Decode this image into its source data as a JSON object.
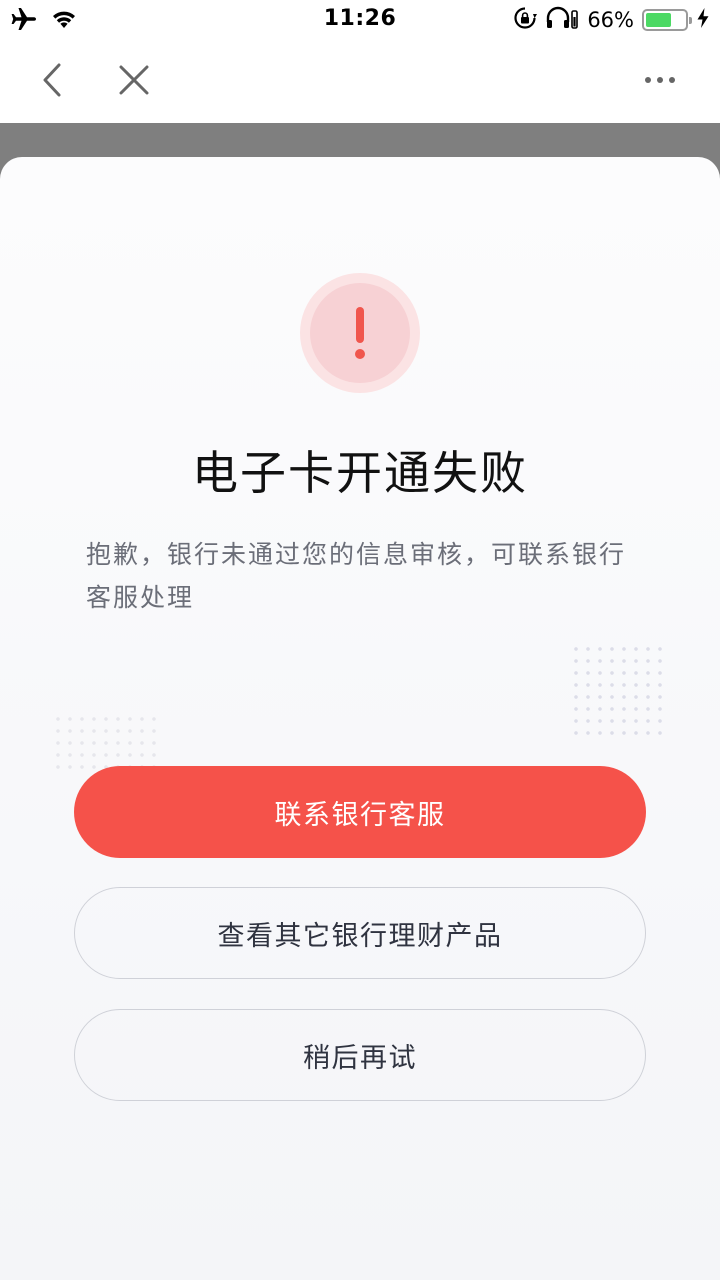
{
  "status_bar": {
    "time": "11:26",
    "battery_percent": "66%",
    "battery_level": 0.66,
    "icons": [
      "airplane-icon",
      "wifi-icon",
      "orientation-lock-icon",
      "headphones-icon",
      "battery-icon",
      "charging-icon"
    ]
  },
  "nav": {
    "back_icon": "chevron-left-icon",
    "close_icon": "close-icon",
    "more_icon": "more-dots-icon"
  },
  "dialog": {
    "icon": "exclamation-icon",
    "title": "电子卡开通失败",
    "message": "抱歉，银行未通过您的信息审核，可联系银行客服处理",
    "buttons": {
      "contact": "联系银行客服",
      "products": "查看其它银行理财产品",
      "later": "稍后再试"
    }
  },
  "colors": {
    "accent": "#f5524a",
    "alert_bg": "#f7d1d4",
    "alert_ring": "#fbe3e4",
    "overlay": "#7f7f7f",
    "battery_green": "#4cd964"
  }
}
